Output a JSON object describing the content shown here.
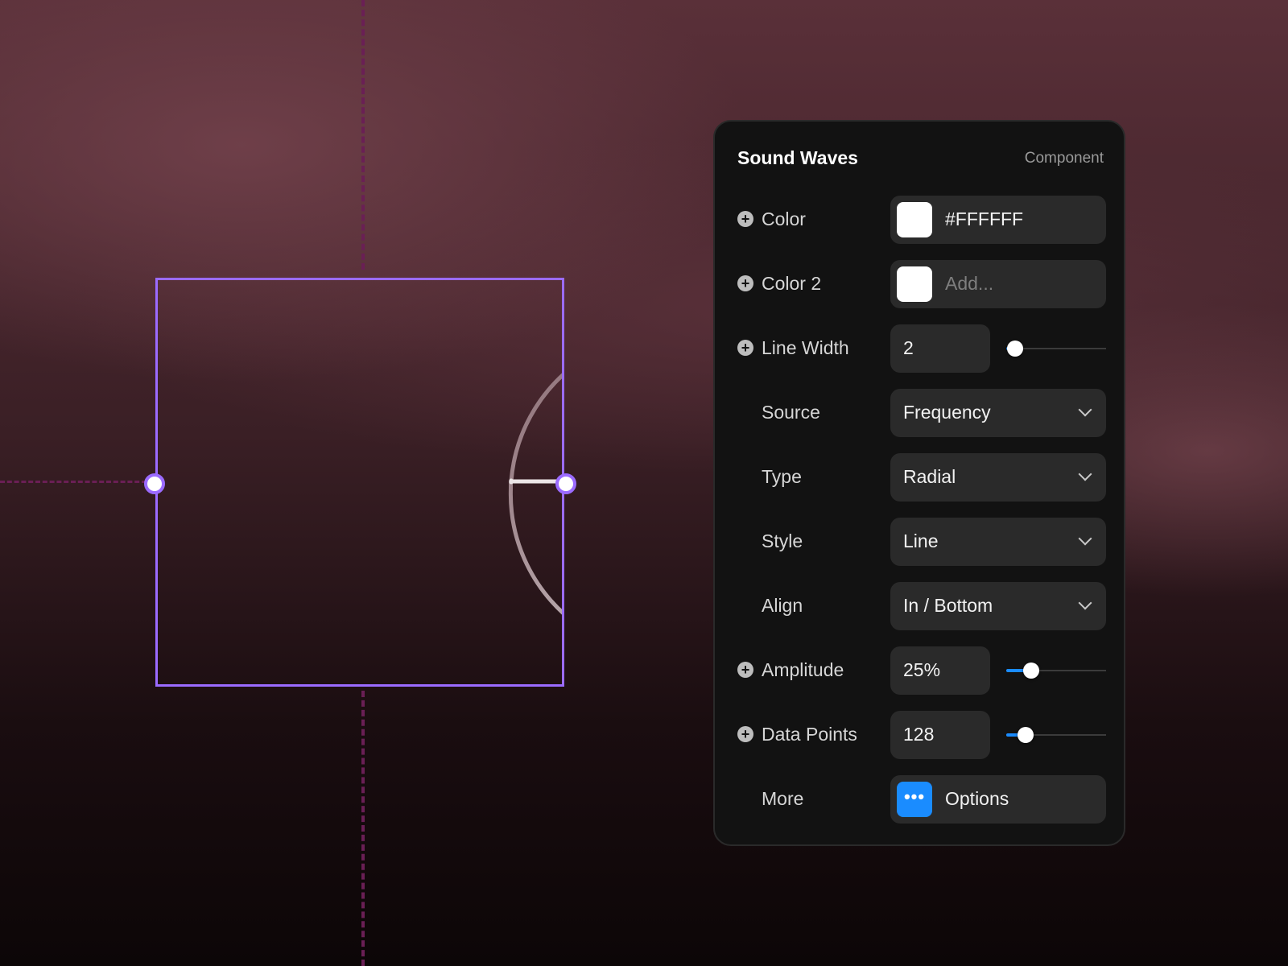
{
  "panel": {
    "title": "Sound Waves",
    "kind": "Component",
    "accent_color": "#1A8CFF",
    "selection_color": "#9B6BFF"
  },
  "rows": {
    "color": {
      "label": "Color",
      "value": "#FFFFFF",
      "swatch": "#FFFFFF"
    },
    "color2": {
      "label": "Color 2",
      "placeholder": "Add...",
      "swatch": "#FFFFFF"
    },
    "line_width": {
      "label": "Line Width",
      "value": "2",
      "slider_fraction": 0.09
    },
    "source": {
      "label": "Source",
      "value": "Frequency"
    },
    "type": {
      "label": "Type",
      "value": "Radial"
    },
    "style": {
      "label": "Style",
      "value": "Line"
    },
    "align": {
      "label": "Align",
      "value": "In / Bottom"
    },
    "amplitude": {
      "label": "Amplitude",
      "value": "25%",
      "slider_fraction": 0.25
    },
    "data_points": {
      "label": "Data Points",
      "value": "128",
      "slider_fraction": 0.19
    },
    "more": {
      "label": "More",
      "button_label": "Options",
      "icon": "ellipsis-icon"
    }
  },
  "icons": {
    "add": "plus-circle-icon",
    "dropdown": "chevron-down-icon"
  }
}
